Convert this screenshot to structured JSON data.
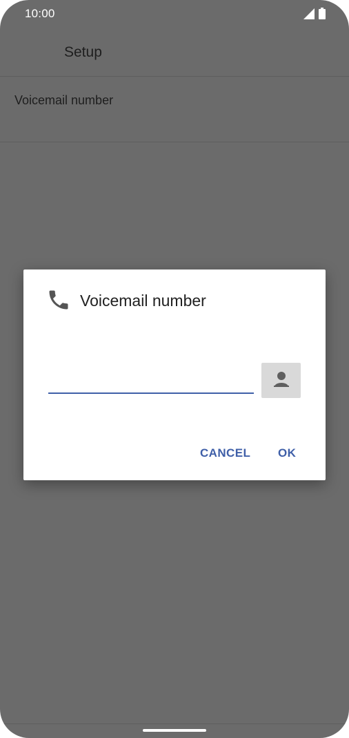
{
  "status_bar": {
    "time": "10:00",
    "icons": [
      "signal-icon",
      "battery-icon"
    ]
  },
  "app_bar": {
    "title": "Setup"
  },
  "settings": {
    "voicemail_row_label": "Voicemail number"
  },
  "dialog": {
    "icon": "phone-icon",
    "title": "Voicemail number",
    "input_value": "",
    "contact_picker_icon": "contact-icon",
    "cancel_label": "CANCEL",
    "ok_label": "OK"
  },
  "colors": {
    "scrim_background": "#6b6b6b",
    "accent": "#3f5fa8",
    "dialog_background": "#ffffff",
    "contact_button_background": "#d9d9d9"
  }
}
